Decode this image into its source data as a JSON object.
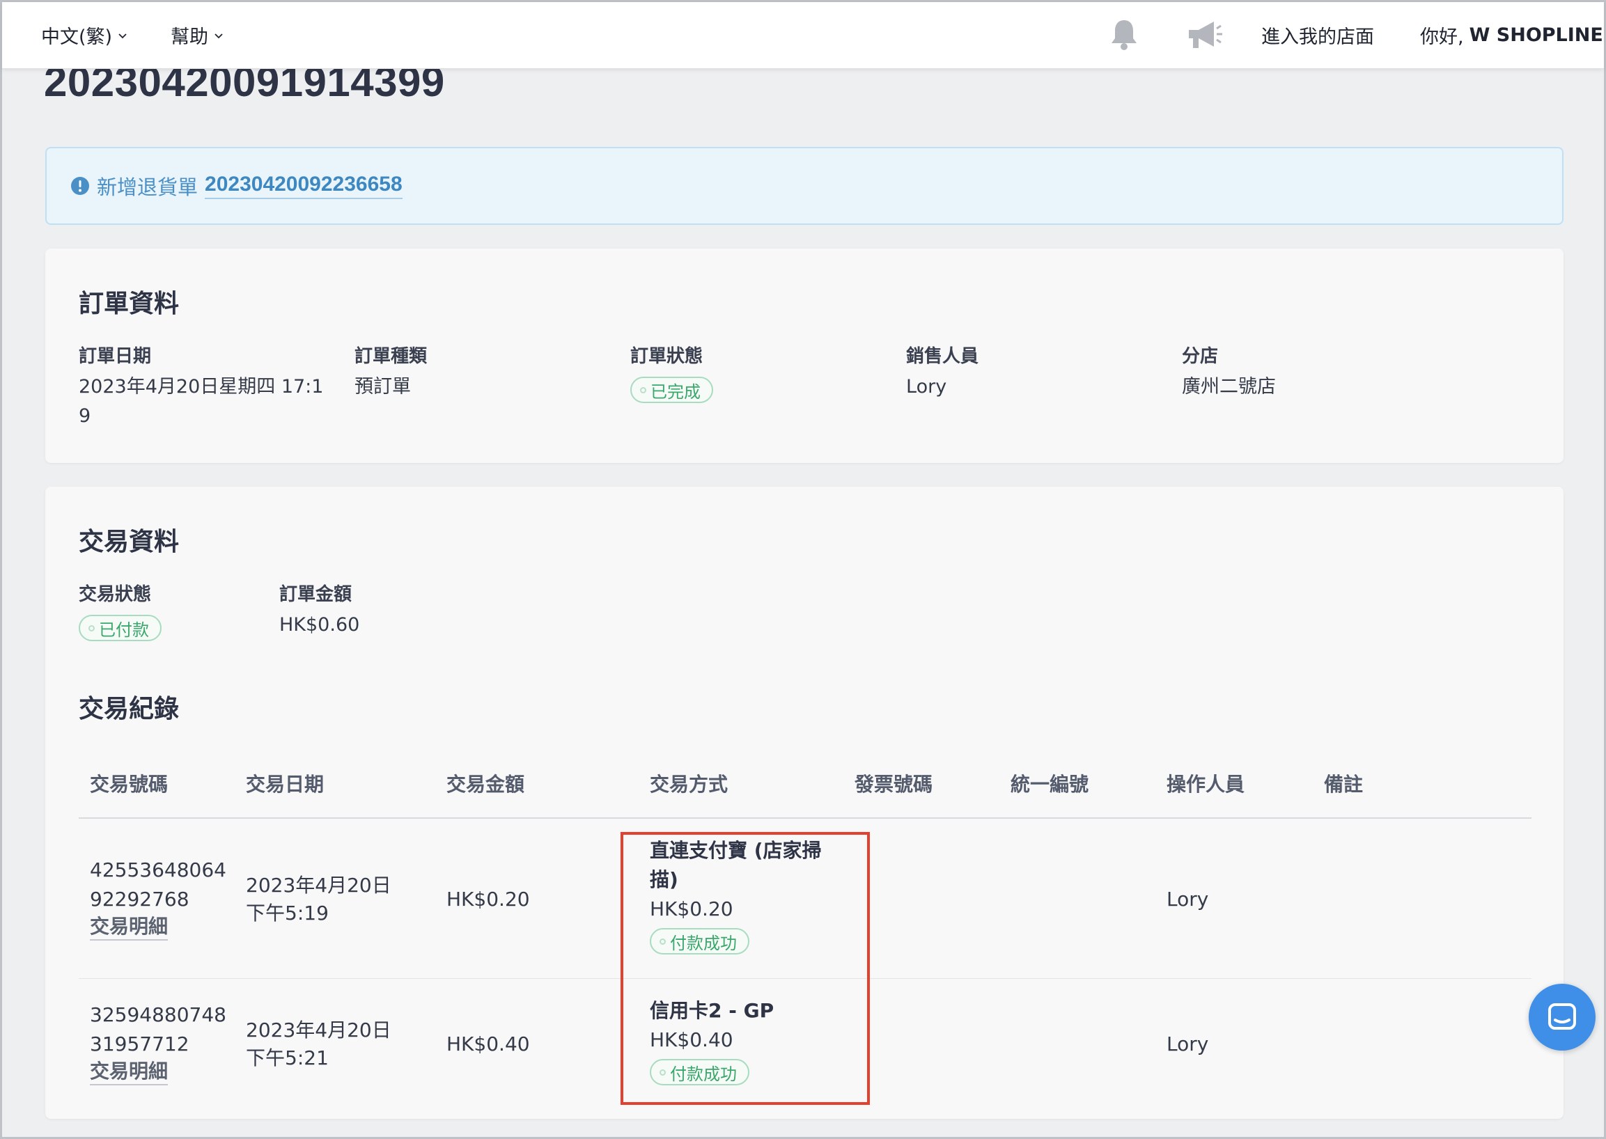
{
  "topbar": {
    "language_label": "中文(繁)",
    "help_label": "幫助",
    "store_link": "進入我的店面",
    "greeting": "你好,",
    "user_name": "W SHOPLINE"
  },
  "order": {
    "number": "20230420091914399"
  },
  "alert": {
    "text": "新增退貨單",
    "return_number": "20230420092236658"
  },
  "order_info": {
    "title": "訂單資料",
    "fields": [
      {
        "label": "訂單日期",
        "value": "2023年4月20日星期四 17:1\n9"
      },
      {
        "label": "訂單種類",
        "value": "預訂單"
      },
      {
        "label": "訂單狀態",
        "value": "已完成"
      },
      {
        "label": "銷售人員",
        "value": "Lory"
      },
      {
        "label": "分店",
        "value": "廣州二號店"
      }
    ]
  },
  "transaction_info": {
    "title": "交易資料",
    "status_label": "交易狀態",
    "status_value": "已付款",
    "amount_label": "訂單金額",
    "amount_value": "HK$0.60"
  },
  "transaction_records": {
    "title": "交易紀錄",
    "columns": [
      "交易號碼",
      "交易日期",
      "交易金額",
      "交易方式",
      "發票號碼",
      "統一編號",
      "操作人員",
      "備註"
    ],
    "rows": [
      {
        "number_line1": "42553648064",
        "number_line2": "92292768",
        "detail_link": "交易明細",
        "date_line1": "2023年4月20日",
        "date_line2": "下午5:19",
        "amount": "HK$0.20",
        "method_line1": "直連支付寶 (店家掃",
        "method_line2": "描)",
        "method_amount": "HK$0.20",
        "method_status": "付款成功",
        "operator": "Lory"
      },
      {
        "number_line1": "32594880748",
        "number_line2": "31957712",
        "detail_link": "交易明細",
        "date_line1": "2023年4月20日",
        "date_line2": "下午5:21",
        "amount": "HK$0.40",
        "method_line1": "信用卡2 - GP",
        "method_amount": "HK$0.40",
        "method_status": "付款成功",
        "operator": "Lory"
      }
    ]
  },
  "colors": {
    "accent_blue": "#3d88c1",
    "success_green": "#3aa86b",
    "highlight_red": "#e4402f",
    "chat_blue": "#3f8fe8"
  },
  "icons": [
    "chevron-down-icon",
    "bell-icon",
    "megaphone-icon",
    "info-icon",
    "chat-icon"
  ]
}
